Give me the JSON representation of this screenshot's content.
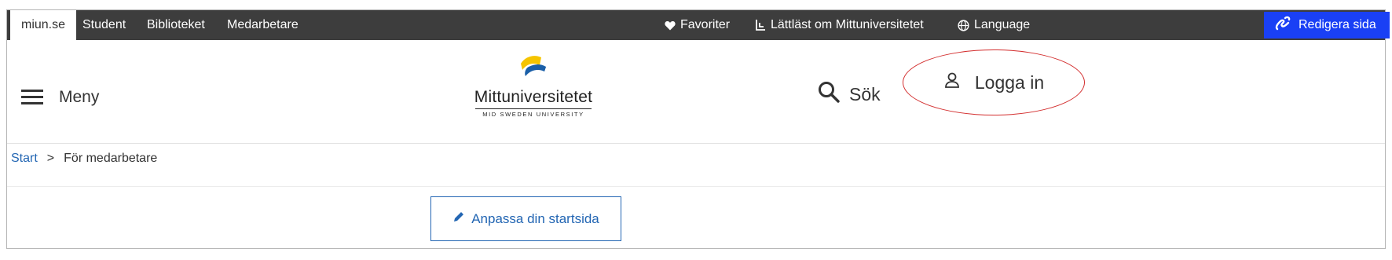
{
  "topbar": {
    "tabs": [
      "miun.se",
      "Student",
      "Biblioteket",
      "Medarbetare"
    ],
    "favorites": "Favoriter",
    "easy_read": "Lättläst om Mittuniversitetet",
    "language": "Language",
    "edit_page": "Redigera sida"
  },
  "header": {
    "menu_label": "Meny",
    "logo_name": "Mittuniversitetet",
    "logo_sub": "MID SWEDEN UNIVERSITY",
    "search_label": "Sök",
    "login_label": "Logga in"
  },
  "breadcrumb": {
    "home": "Start",
    "separator": ">",
    "current": "För medarbetare"
  },
  "main": {
    "customize_button": "Anpassa din startsida"
  },
  "colors": {
    "topbar_bg": "#3d3d3d",
    "edit_button_bg": "#1a40f5",
    "link_blue": "#2366b3",
    "annotation_red": "#d32f2f",
    "logo_blue": "#1a5fa8",
    "logo_yellow": "#f5c400"
  }
}
